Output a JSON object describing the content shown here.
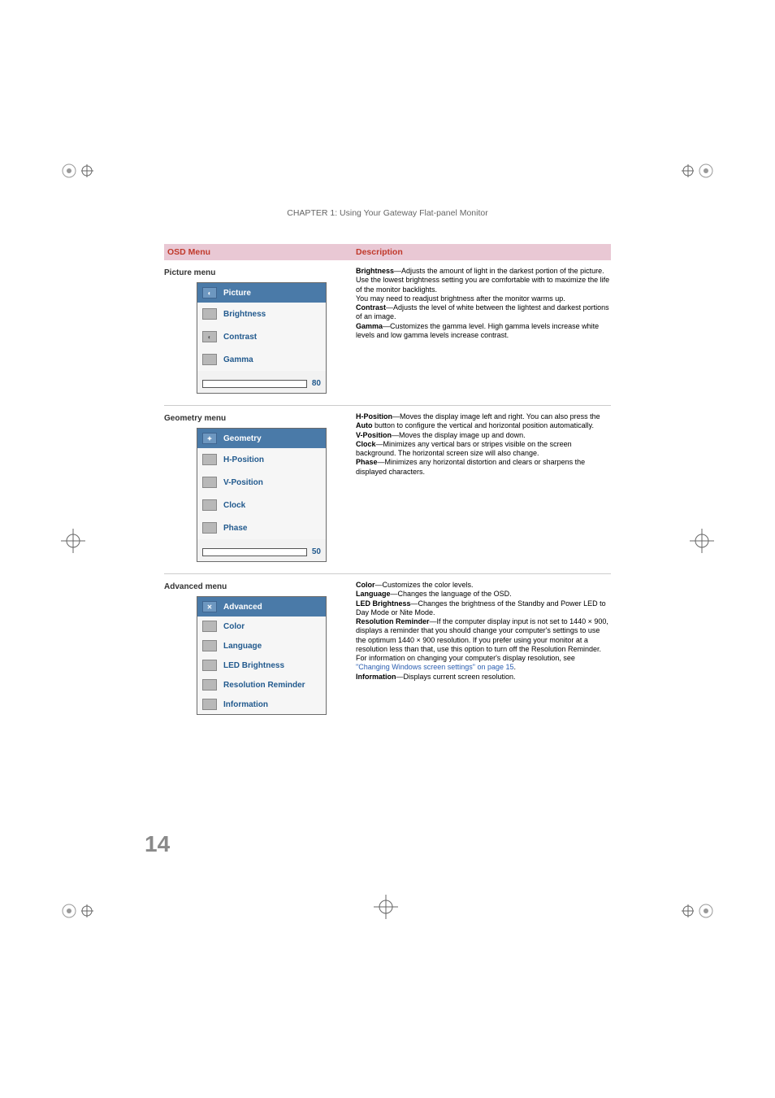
{
  "chapter_header": "CHAPTER 1: Using Your Gateway Flat-panel Monitor",
  "page_number": "14",
  "table_header": {
    "col1": "OSD Menu",
    "col2": "Description"
  },
  "rows": [
    {
      "menu_title": "Picture menu",
      "osd_header": "Picture",
      "items": [
        "Brightness",
        "Contrast",
        "Gamma"
      ],
      "slider_value": "80",
      "desc": {
        "p1b": "Brightness",
        "p1": "—Adjusts the amount of light in the darkest portion of the picture. Use the lowest brightness setting you are comfortable with to maximize the life of the monitor backlights.",
        "p1b2": "You may need to readjust brightness after the monitor warms up.",
        "p2b": "Contrast",
        "p2": "—Adjusts the level of white between the lightest and darkest portions of an image.",
        "p3b": "Gamma",
        "p3": "—Customizes the gamma level. High gamma levels increase white levels and low gamma levels increase contrast."
      }
    },
    {
      "menu_title": "Geometry menu",
      "osd_header": "Geometry",
      "items": [
        "H-Position",
        "V-Position",
        "Clock",
        "Phase"
      ],
      "slider_value": "50",
      "desc": {
        "p1b": "H-Position",
        "p1": "—Moves the display image left and right. You can also press the ",
        "p1b2": "Auto",
        "p1c": " button to configure the vertical and horizontal position automatically.",
        "p2b": "V-Position",
        "p2": "—Moves the display image up and down.",
        "p3b": "Clock",
        "p3": "—Minimizes any vertical bars or stripes visible on the screen background. The horizontal screen size will also change.",
        "p4b": "Phase",
        "p4": "—Minimizes any horizontal distortion and clears or sharpens the displayed characters."
      }
    },
    {
      "menu_title": "Advanced menu",
      "osd_header": "Advanced",
      "items": [
        "Color",
        "Language",
        "LED Brightness",
        "Resolution Reminder",
        "Information"
      ],
      "slider_value": "",
      "desc": {
        "p1b": "Color",
        "p1": "—Customizes the color levels.",
        "p2b": "Language",
        "p2": "—Changes the language of the OSD.",
        "p3b": "LED Brightness",
        "p3": "—Changes the brightness of the Standby and Power LED to Day Mode or Nite Mode.",
        "p4b": "Resolution Reminder",
        "p4": "—If the computer display input is not set to 1440 × 900, displays a reminder that you should change your computer's settings to use the optimum 1440 × 900 resolution. If you prefer using your monitor at a resolution less than that, use this option to turn off the Resolution Reminder. For information on changing your computer's display resolution, see ",
        "p4link": "\"Changing Windows screen settings\" on page 15",
        "p4end": ".",
        "p5b": "Information",
        "p5": "—Displays current screen resolution."
      }
    }
  ]
}
